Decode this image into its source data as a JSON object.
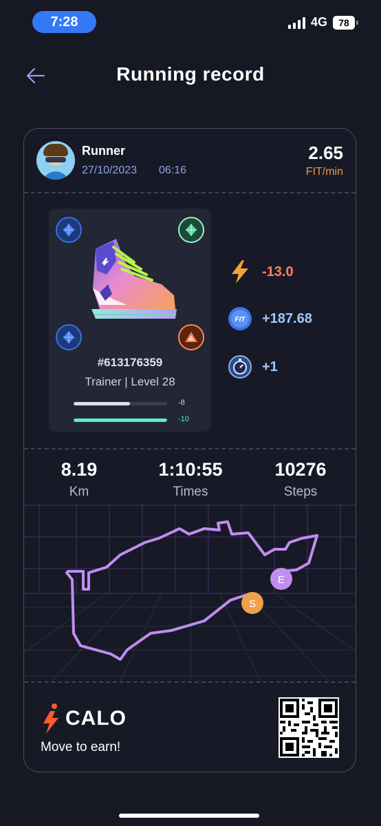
{
  "status_bar": {
    "time": "7:28",
    "network": "4G",
    "battery": "78"
  },
  "header": {
    "title": "Running record"
  },
  "runner": {
    "name": "Runner",
    "date": "27/10/2023",
    "clock": "06:16",
    "rate_value": "2.65",
    "rate_unit": "FIT/min"
  },
  "shoe": {
    "id": "#613176359",
    "level_text": "Trainer | Level 28",
    "bar1_value": "-8",
    "bar1_fill": 0.6,
    "bar2_value": "-10",
    "bar2_fill": 1.0
  },
  "rewards": {
    "energy": "-13.0",
    "fit": "+187.68",
    "gem": "+1",
    "fit_icon_label": "FIT"
  },
  "stats": [
    {
      "value": "8.19",
      "label": "Km"
    },
    {
      "value": "1:10:55",
      "label": "Times"
    },
    {
      "value": "10276",
      "label": "Steps"
    }
  ],
  "map": {
    "start_label": "S",
    "end_label": "E"
  },
  "footer": {
    "brand": "CALO",
    "tagline": "Move to earn!"
  },
  "colors": {
    "accent_orange": "#f0954c",
    "route": "#c08df2",
    "start_marker": "#f0a04d",
    "end_marker": "#c08df2"
  }
}
